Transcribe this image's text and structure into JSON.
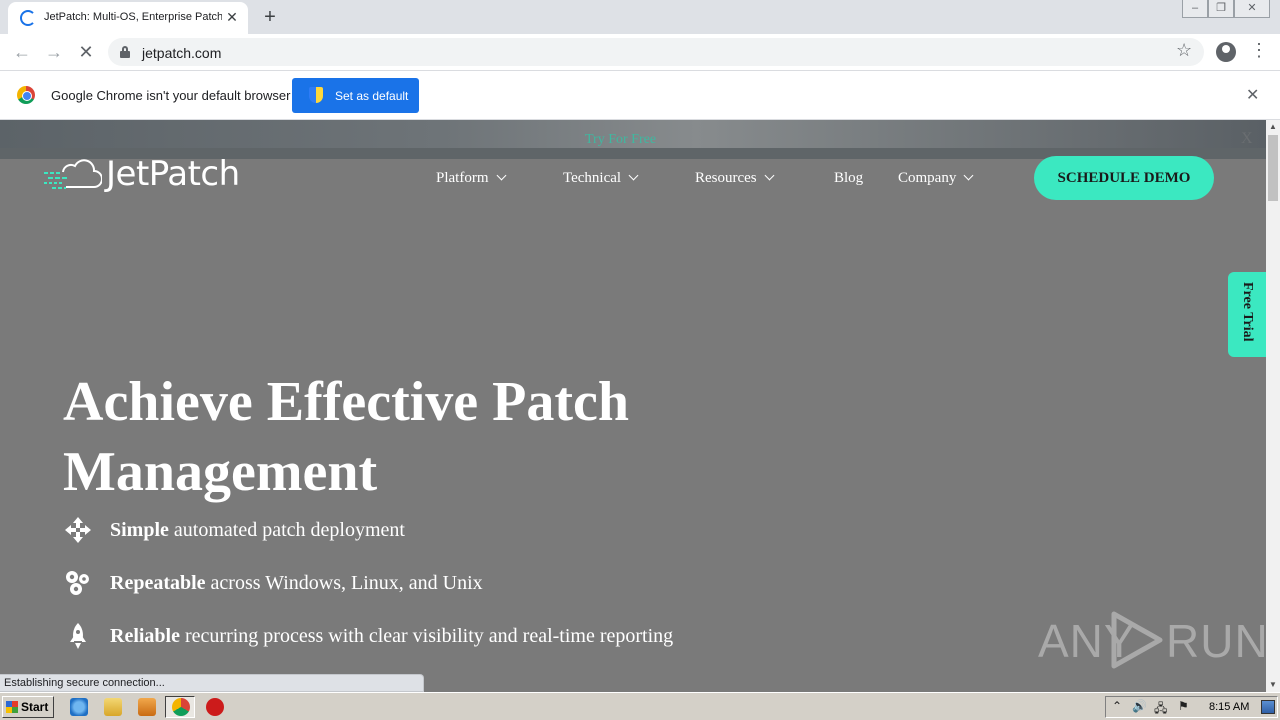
{
  "browser": {
    "tab": {
      "title": "JetPatch: Multi-OS, Enterprise Patch",
      "close_glyph": "✕"
    },
    "new_tab_glyph": "+",
    "window_controls": [
      "–",
      "❐",
      "✕"
    ],
    "nav": {
      "back_glyph": "←",
      "forward_glyph": "→",
      "stop_glyph": "✕"
    },
    "address": "jetpatch.com",
    "star_glyph": "☆",
    "menu_glyph": "⋮"
  },
  "infobar": {
    "message": "Google Chrome isn't your default browser",
    "button_label": "Set as default",
    "close_glyph": "✕"
  },
  "page": {
    "banner": {
      "text": "Try For Free",
      "close_glyph": "X"
    },
    "logo_text": "JetPatch",
    "nav": {
      "platform": "Platform",
      "technical": "Technical",
      "resources": "Resources",
      "blog": "Blog",
      "company": "Company"
    },
    "cta_label": "SCHEDULE DEMO",
    "free_trial_label": "Free Trial",
    "hero": {
      "title": "Achieve Effective Patch Management",
      "features": [
        {
          "bold": "Simple",
          "rest": " automated patch deployment",
          "icon": "arrows-move-icon"
        },
        {
          "bold": "Repeatable",
          "rest": " across Windows, Linux, and Unix",
          "icon": "gears-icon"
        },
        {
          "bold": "Reliable",
          "rest": " recurring process with clear visibility and real-time reporting",
          "icon": "rocket-icon"
        }
      ]
    },
    "watermark": {
      "left": "ANY",
      "right": "RUN"
    },
    "accent_color": "#3be8c1",
    "background_color": "#7a7a7a"
  },
  "status_text": "Establishing secure connection...",
  "taskbar": {
    "start_label": "Start",
    "clock": "8:15 AM"
  }
}
